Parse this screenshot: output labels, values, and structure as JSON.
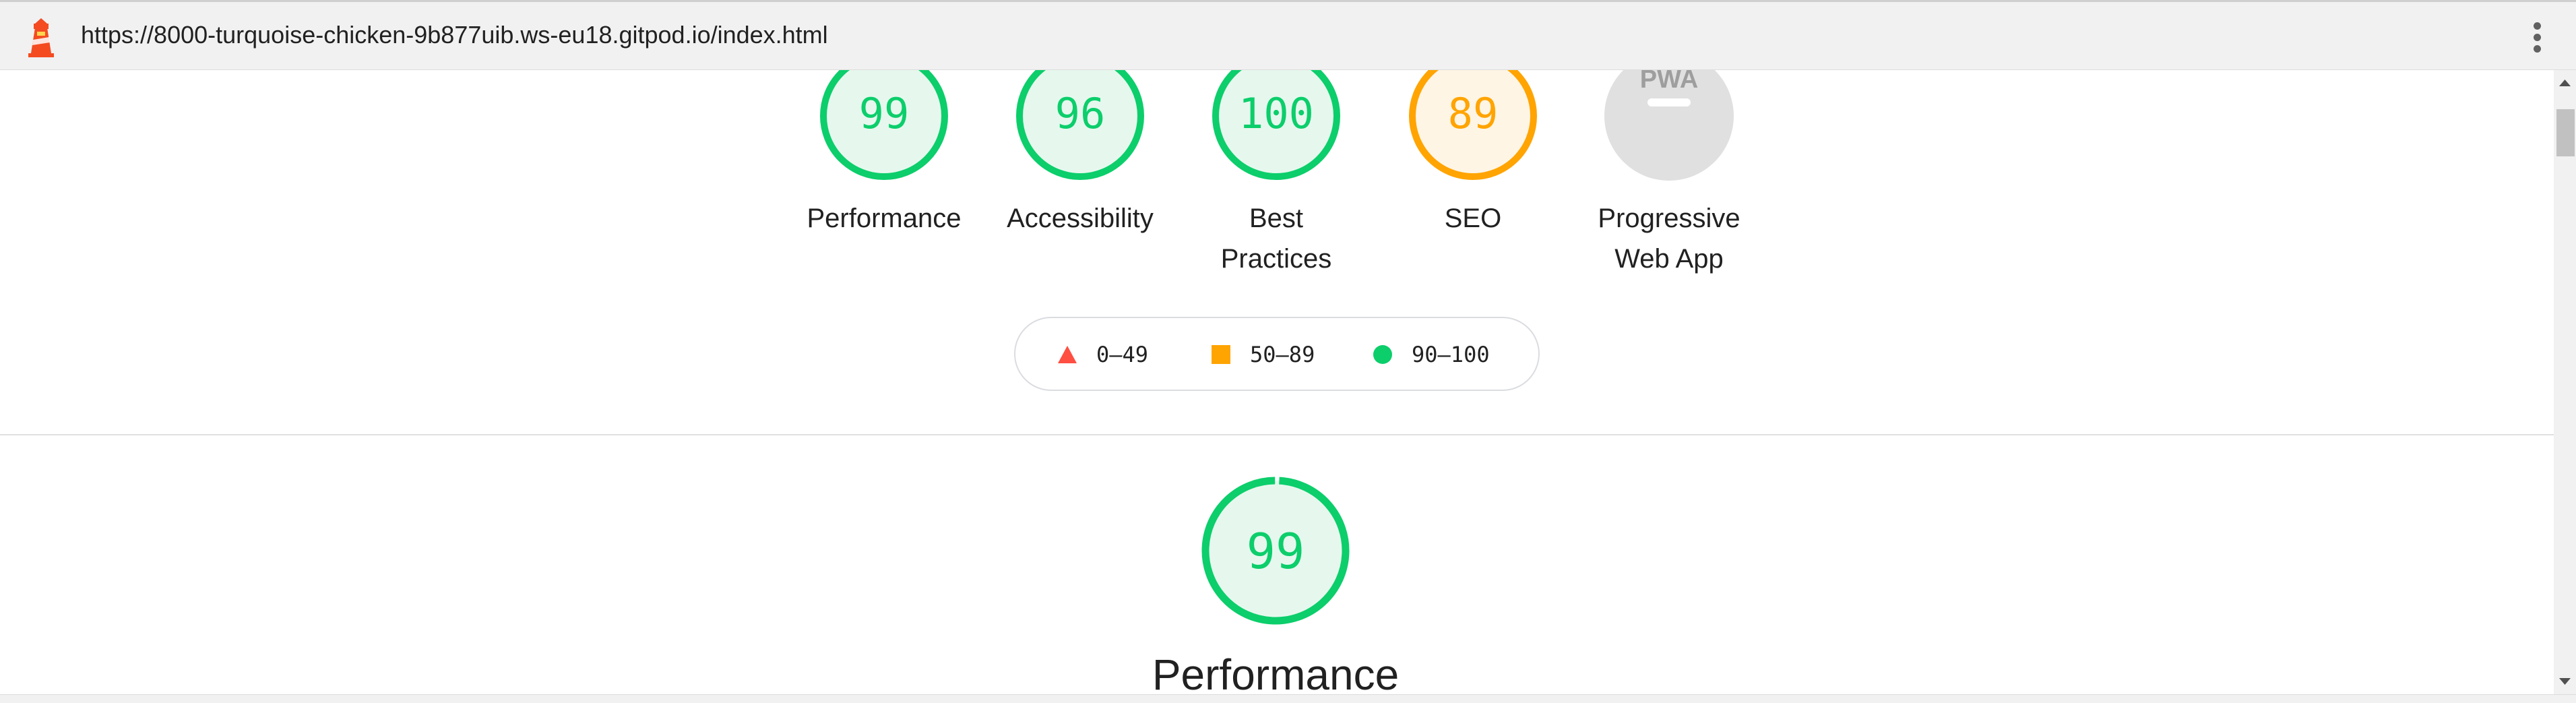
{
  "browser": {
    "url": "https://8000-turquoise-chicken-9b877uib.ws-eu18.gitpod.io/index.html"
  },
  "categories": [
    {
      "label_lines": [
        "Performance"
      ],
      "score": "99",
      "status": "pass"
    },
    {
      "label_lines": [
        "Accessibility"
      ],
      "score": "96",
      "status": "pass"
    },
    {
      "label_lines": [
        "Best",
        "Practices"
      ],
      "score": "100",
      "status": "pass"
    },
    {
      "label_lines": [
        "SEO"
      ],
      "score": "89",
      "status": "average"
    },
    {
      "label_lines": [
        "Progressive",
        "Web App"
      ],
      "score": "",
      "status": "na",
      "badge": "PWA"
    }
  ],
  "legend": [
    {
      "range": "0–49",
      "shape": "triangle",
      "color": "#ff4e42"
    },
    {
      "range": "50–89",
      "shape": "square",
      "color": "#ffa400"
    },
    {
      "range": "90–100",
      "shape": "circle",
      "color": "#0cce6b"
    }
  ],
  "section": {
    "title": "Performance",
    "score": "99",
    "score_fraction": 0.99
  },
  "colors": {
    "pass": "#0cce6b",
    "pass_text": "#0cce6b",
    "pass_bg": "#e6f8ee",
    "average": "#ffa400",
    "average_text": "#ffa400",
    "average_bg": "#fff5e5",
    "na": "#cccccc",
    "na_bg": "#e0e0e0",
    "brand": "#f44b21"
  },
  "icons": {
    "app": "lighthouse-icon",
    "menu": "kebab-menu-icon"
  }
}
